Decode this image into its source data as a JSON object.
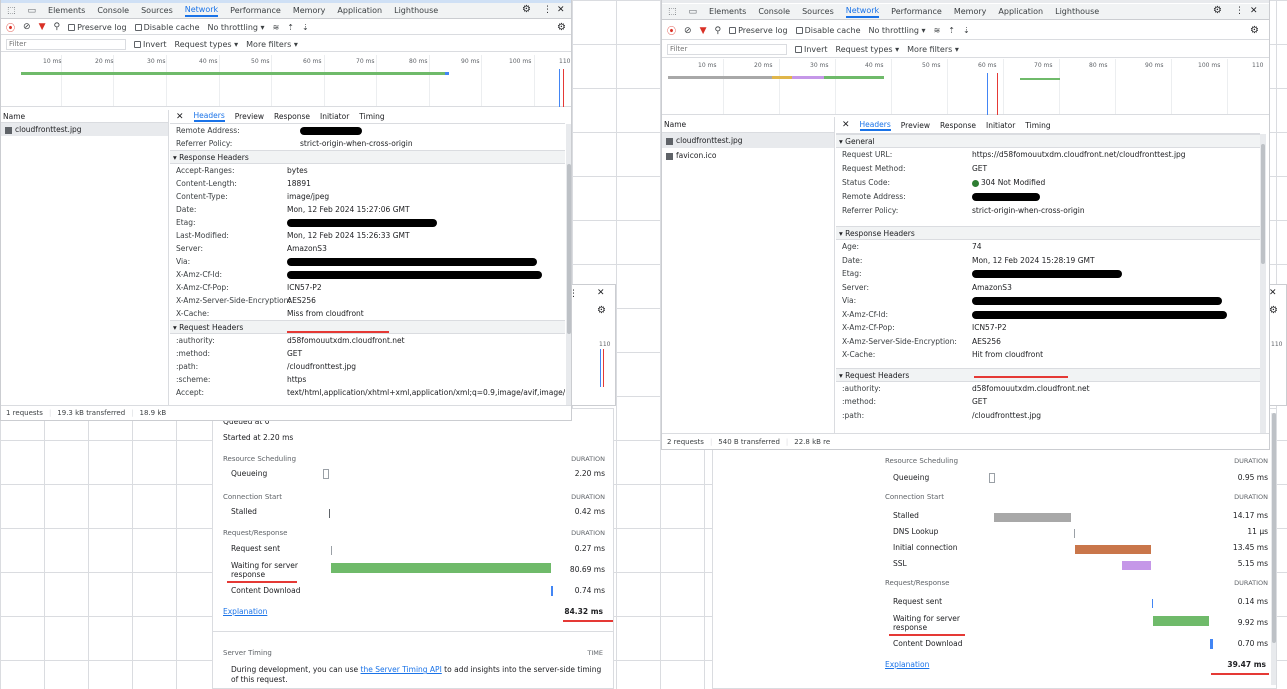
{
  "left": {
    "tabs": [
      "Elements",
      "Console",
      "Sources",
      "Network",
      "Performance",
      "Memory",
      "Application",
      "Lighthouse"
    ],
    "active_tab": "Network",
    "toolbar": {
      "preserve_log": "Preserve log",
      "disable_cache": "Disable cache",
      "throttling": "No throttling"
    },
    "filter": {
      "placeholder": "Filter",
      "invert": "Invert",
      "request_types": "Request types",
      "more_filters": "More filters"
    },
    "ticks": [
      "10 ms",
      "20 ms",
      "30 ms",
      "40 ms",
      "50 ms",
      "60 ms",
      "70 ms",
      "80 ms",
      "90 ms",
      "100 ms",
      "110"
    ],
    "name_header": "Name",
    "files": [
      "cloudfronttest.jpg"
    ],
    "detail_tabs": [
      "Headers",
      "Preview",
      "Response",
      "Initiator",
      "Timing"
    ],
    "active_detail_tab": "Headers",
    "general_rows": [
      [
        "Remote Address:",
        ""
      ],
      [
        "Referrer Policy:",
        "strict-origin-when-cross-origin"
      ]
    ],
    "response_headers_title": "Response Headers",
    "response_rows": [
      [
        "Accept-Ranges:",
        "bytes"
      ],
      [
        "Content-Length:",
        "18891"
      ],
      [
        "Content-Type:",
        "image/jpeg"
      ],
      [
        "Date:",
        "Mon, 12 Feb 2024 15:27:06 GMT"
      ],
      [
        "Etag:",
        ""
      ],
      [
        "Last-Modified:",
        "Mon, 12 Feb 2024 15:26:33 GMT"
      ],
      [
        "Server:",
        "AmazonS3"
      ],
      [
        "Via:",
        ""
      ],
      [
        "X-Amz-Cf-Id:",
        ""
      ],
      [
        "X-Amz-Cf-Pop:",
        "ICN57-P2"
      ],
      [
        "X-Amz-Server-Side-Encryption:",
        "AES256"
      ],
      [
        "X-Cache:",
        "Miss from cloudfront"
      ]
    ],
    "request_headers_title": "Request Headers",
    "request_rows": [
      [
        ":authority:",
        "d58fomouutxdm.cloudfront.net"
      ],
      [
        ":method:",
        "GET"
      ],
      [
        ":path:",
        "/cloudfronttest.jpg"
      ],
      [
        ":scheme:",
        "https"
      ],
      [
        "Accept:",
        "text/html,application/xhtml+xml,application/xml;q=0.9,image/avif,image/"
      ]
    ],
    "status": {
      "requests": "1 requests",
      "transferred": "19.3 kB transferred",
      "resources": "18.9 kB"
    },
    "timing": {
      "queued": "Queued at 0",
      "started": "Started at 2.20 ms",
      "sections": [
        {
          "title": "Resource Scheduling",
          "dur": "DURATION",
          "rows": [
            {
              "label": "Queueing",
              "value": "2.20 ms"
            }
          ]
        },
        {
          "title": "Connection Start",
          "dur": "DURATION",
          "rows": [
            {
              "label": "Stalled",
              "value": "0.42 ms"
            }
          ]
        },
        {
          "title": "Request/Response",
          "dur": "DURATION",
          "rows": [
            {
              "label": "Request sent",
              "value": "0.27 ms"
            },
            {
              "label": "Waiting for server response",
              "value": "80.69 ms"
            },
            {
              "label": "Content Download",
              "value": "0.74 ms"
            }
          ]
        }
      ],
      "explanation": "Explanation",
      "total": "84.32 ms",
      "server_timing": "Server Timing",
      "time": "TIME",
      "server_text_pre": "During development, you can use ",
      "server_link": "the Server Timing API",
      "server_text_post": " to add insights into the server-side timing of this request."
    },
    "stub": {
      "tick": "110"
    }
  },
  "right": {
    "tabs": [
      "Elements",
      "Console",
      "Sources",
      "Network",
      "Performance",
      "Memory",
      "Application",
      "Lighthouse"
    ],
    "active_tab": "Network",
    "toolbar": {
      "preserve_log": "Preserve log",
      "disable_cache": "Disable cache",
      "throttling": "No throttling"
    },
    "filter": {
      "placeholder": "Filter",
      "invert": "Invert",
      "request_types": "Request types",
      "more_filters": "More filters"
    },
    "ticks": [
      "10 ms",
      "20 ms",
      "30 ms",
      "40 ms",
      "50 ms",
      "60 ms",
      "70 ms",
      "80 ms",
      "90 ms",
      "100 ms",
      "110"
    ],
    "name_header": "Name",
    "files": [
      "cloudfronttest.jpg",
      "favicon.ico"
    ],
    "detail_tabs": [
      "Headers",
      "Preview",
      "Response",
      "Initiator",
      "Timing"
    ],
    "active_detail_tab": "Headers",
    "general_title": "General",
    "general_rows": [
      [
        "Request URL:",
        "https://d58fomouutxdm.cloudfront.net/cloudfronttest.jpg"
      ],
      [
        "Request Method:",
        "GET"
      ],
      [
        "Status Code:",
        "304 Not Modified"
      ],
      [
        "Remote Address:",
        ""
      ],
      [
        "Referrer Policy:",
        "strict-origin-when-cross-origin"
      ]
    ],
    "response_headers_title": "Response Headers",
    "response_rows": [
      [
        "Age:",
        "74"
      ],
      [
        "Date:",
        "Mon, 12 Feb 2024 15:28:19 GMT"
      ],
      [
        "Etag:",
        ""
      ],
      [
        "Server:",
        "AmazonS3"
      ],
      [
        "Via:",
        ""
      ],
      [
        "X-Amz-Cf-Id:",
        ""
      ],
      [
        "X-Amz-Cf-Pop:",
        "ICN57-P2"
      ],
      [
        "X-Amz-Server-Side-Encryption:",
        "AES256"
      ],
      [
        "X-Cache:",
        "Hit from cloudfront"
      ]
    ],
    "request_headers_title": "Request Headers",
    "request_rows": [
      [
        ":authority:",
        "d58fomouutxdm.cloudfront.net"
      ],
      [
        ":method:",
        "GET"
      ],
      [
        ":path:",
        "/cloudfronttest.jpg"
      ]
    ],
    "status": {
      "requests": "2 requests",
      "transferred": "540 B transferred",
      "resources": "22.8 kB re"
    },
    "timing": {
      "sections": [
        {
          "title": "Resource Scheduling",
          "dur": "DURATION",
          "rows": [
            {
              "label": "Queueing",
              "value": "0.95 ms"
            }
          ]
        },
        {
          "title": "Connection Start",
          "dur": "DURATION",
          "rows": [
            {
              "label": "Stalled",
              "value": "14.17 ms"
            },
            {
              "label": "DNS Lookup",
              "value": "11 µs"
            },
            {
              "label": "Initial connection",
              "value": "13.45 ms"
            },
            {
              "label": "SSL",
              "value": "5.15 ms"
            }
          ]
        },
        {
          "title": "Request/Response",
          "dur": "DURATION",
          "rows": [
            {
              "label": "Request sent",
              "value": "0.14 ms"
            },
            {
              "label": "Waiting for server response",
              "value": "9.92 ms"
            },
            {
              "label": "Content Download",
              "value": "0.70 ms"
            }
          ]
        }
      ],
      "explanation": "Explanation",
      "total": "39.47 ms"
    },
    "stub": {
      "tick": "110"
    }
  },
  "colors": {
    "active": "#1a73e8",
    "waiting": "#6fba6a",
    "download": "#4285f4",
    "stalled": "#a8a8a8",
    "connect": "#c9764a",
    "ssl": "#c597e8",
    "red_underline": "#e53935",
    "status_ok": "#2e7d32"
  }
}
